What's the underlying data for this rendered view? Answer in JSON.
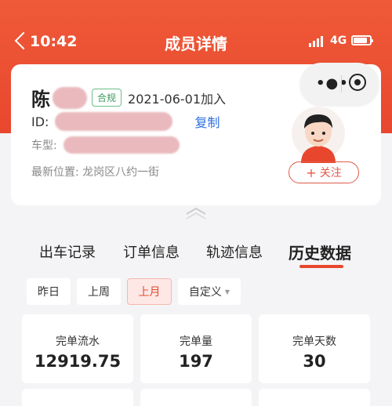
{
  "status_bar": {
    "time": "10:42",
    "network": "4G"
  },
  "nav": {
    "title": "成员详情",
    "back_icon": "back-chevron-icon"
  },
  "member": {
    "surname": "陈",
    "compliance_badge": "合规",
    "join_date": "2021-06-01加入",
    "id_label": "ID:",
    "copy_label": "复制",
    "car_type_label": "车型:",
    "location": "最新位置: 龙岗区八约一街",
    "follow_label": "关注",
    "follow_icon": "plus-icon",
    "avatar_icon": "driver-avatar-icon"
  },
  "capsule": {
    "more_icon": "more-dots-icon",
    "close_icon": "target-circle-icon"
  },
  "tabs": [
    {
      "label": "出车记录",
      "active": false
    },
    {
      "label": "订单信息",
      "active": false
    },
    {
      "label": "轨迹信息",
      "active": false
    },
    {
      "label": "历史数据",
      "active": true
    }
  ],
  "filters": [
    {
      "label": "昨日",
      "active": false
    },
    {
      "label": "上周",
      "active": false
    },
    {
      "label": "上月",
      "active": true
    },
    {
      "label": "自定义",
      "active": false
    }
  ],
  "stats": [
    {
      "label": "完单流水",
      "value": "12919.75"
    },
    {
      "label": "完单量",
      "value": "197"
    },
    {
      "label": "完单天数",
      "value": "30"
    }
  ],
  "colors": {
    "accent": "#e8472e",
    "link": "#2f6fe0",
    "badge": "#3f9a5f"
  }
}
